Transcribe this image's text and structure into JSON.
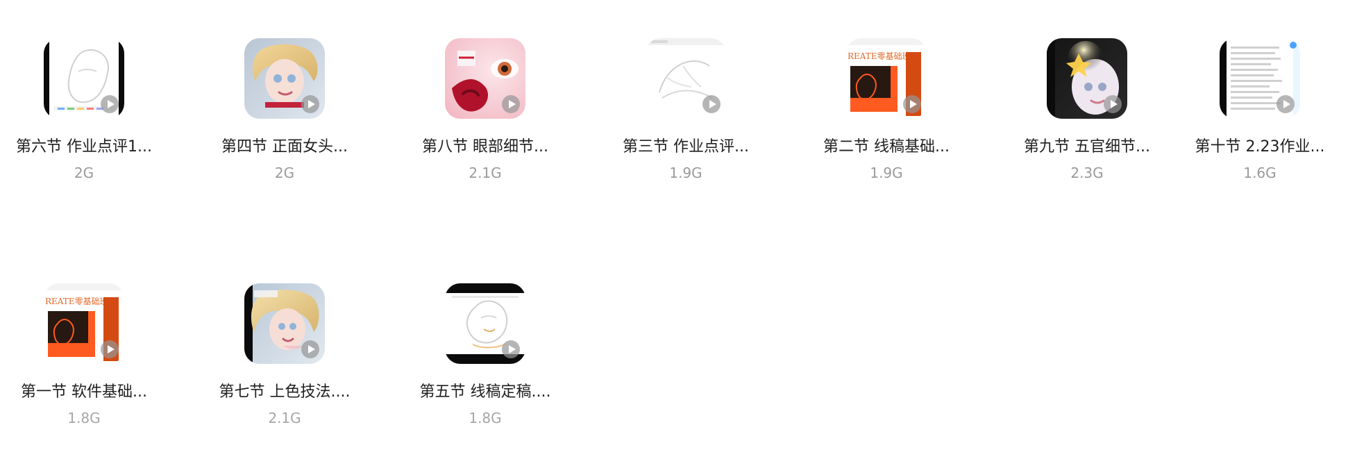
{
  "videos": [
    {
      "title": "第六节 作业点评1...",
      "size": "2G"
    },
    {
      "title": "第四节 正面女头...",
      "size": "2G"
    },
    {
      "title": "第八节 眼部细节...",
      "size": "2.1G"
    },
    {
      "title": "第三节 作业点评...",
      "size": "1.9G"
    },
    {
      "title": "第二节 线稿基础...",
      "size": "1.9G"
    },
    {
      "title": "第九节 五官细节...",
      "size": "2.3G"
    },
    {
      "title": "第十节 2.23作业...",
      "size": "1.6G"
    },
    {
      "title": "第一节 软件基础...",
      "size": "1.8G"
    },
    {
      "title": "第七节 上色技法....",
      "size": "2.1G"
    },
    {
      "title": "第五节 线稿定稿....",
      "size": "1.8G"
    }
  ],
  "thumbnail_text": {
    "create_banner": "REATE零基础班"
  },
  "icons": {
    "play": "play-icon"
  }
}
